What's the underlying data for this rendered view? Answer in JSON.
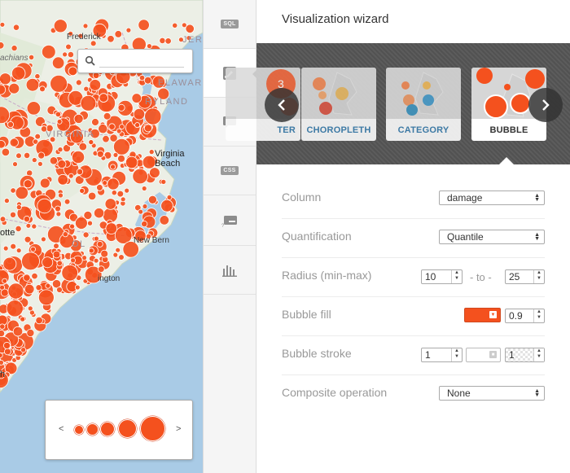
{
  "map": {
    "labels": {
      "frederick": "Frederick",
      "jersey": "JERS",
      "delaware": "ELAWARE",
      "maryland": "RYLAND",
      "lachians": "achians",
      "virginia_state": "VIRGINIA",
      "virginia_beach": "Virginia\nBeach",
      "new_bern": "New Bern",
      "wilmington": "ington",
      "otte": "otte",
      "h": "h",
      "ol": "OL"
    },
    "search": {
      "placeholder": ""
    },
    "legend": {
      "prev": "<",
      "next": ">"
    },
    "bubble_color": "#f4511e"
  },
  "toolbar": {
    "sql": "SQL",
    "css": "CSS"
  },
  "panel": {
    "title": "Visualization wizard",
    "cards": [
      {
        "label": "TER"
      },
      {
        "label": "CHOROPLETH"
      },
      {
        "label": "CATEGORY"
      },
      {
        "label": "BUBBLE"
      }
    ],
    "accent_color": "#3a7fb0",
    "rows": {
      "column": {
        "label": "Column",
        "value": "damage"
      },
      "quantification": {
        "label": "Quantification",
        "value": "Quantile"
      },
      "radius": {
        "label": "Radius (min-max)",
        "min": "10",
        "to": "- to -",
        "max": "25"
      },
      "fill": {
        "label": "Bubble fill",
        "color": "#f4511e",
        "opacity": "0.9"
      },
      "stroke": {
        "label": "Bubble stroke",
        "width": "1",
        "opacity": "1"
      },
      "composite": {
        "label": "Composite operation",
        "value": "None"
      }
    }
  }
}
